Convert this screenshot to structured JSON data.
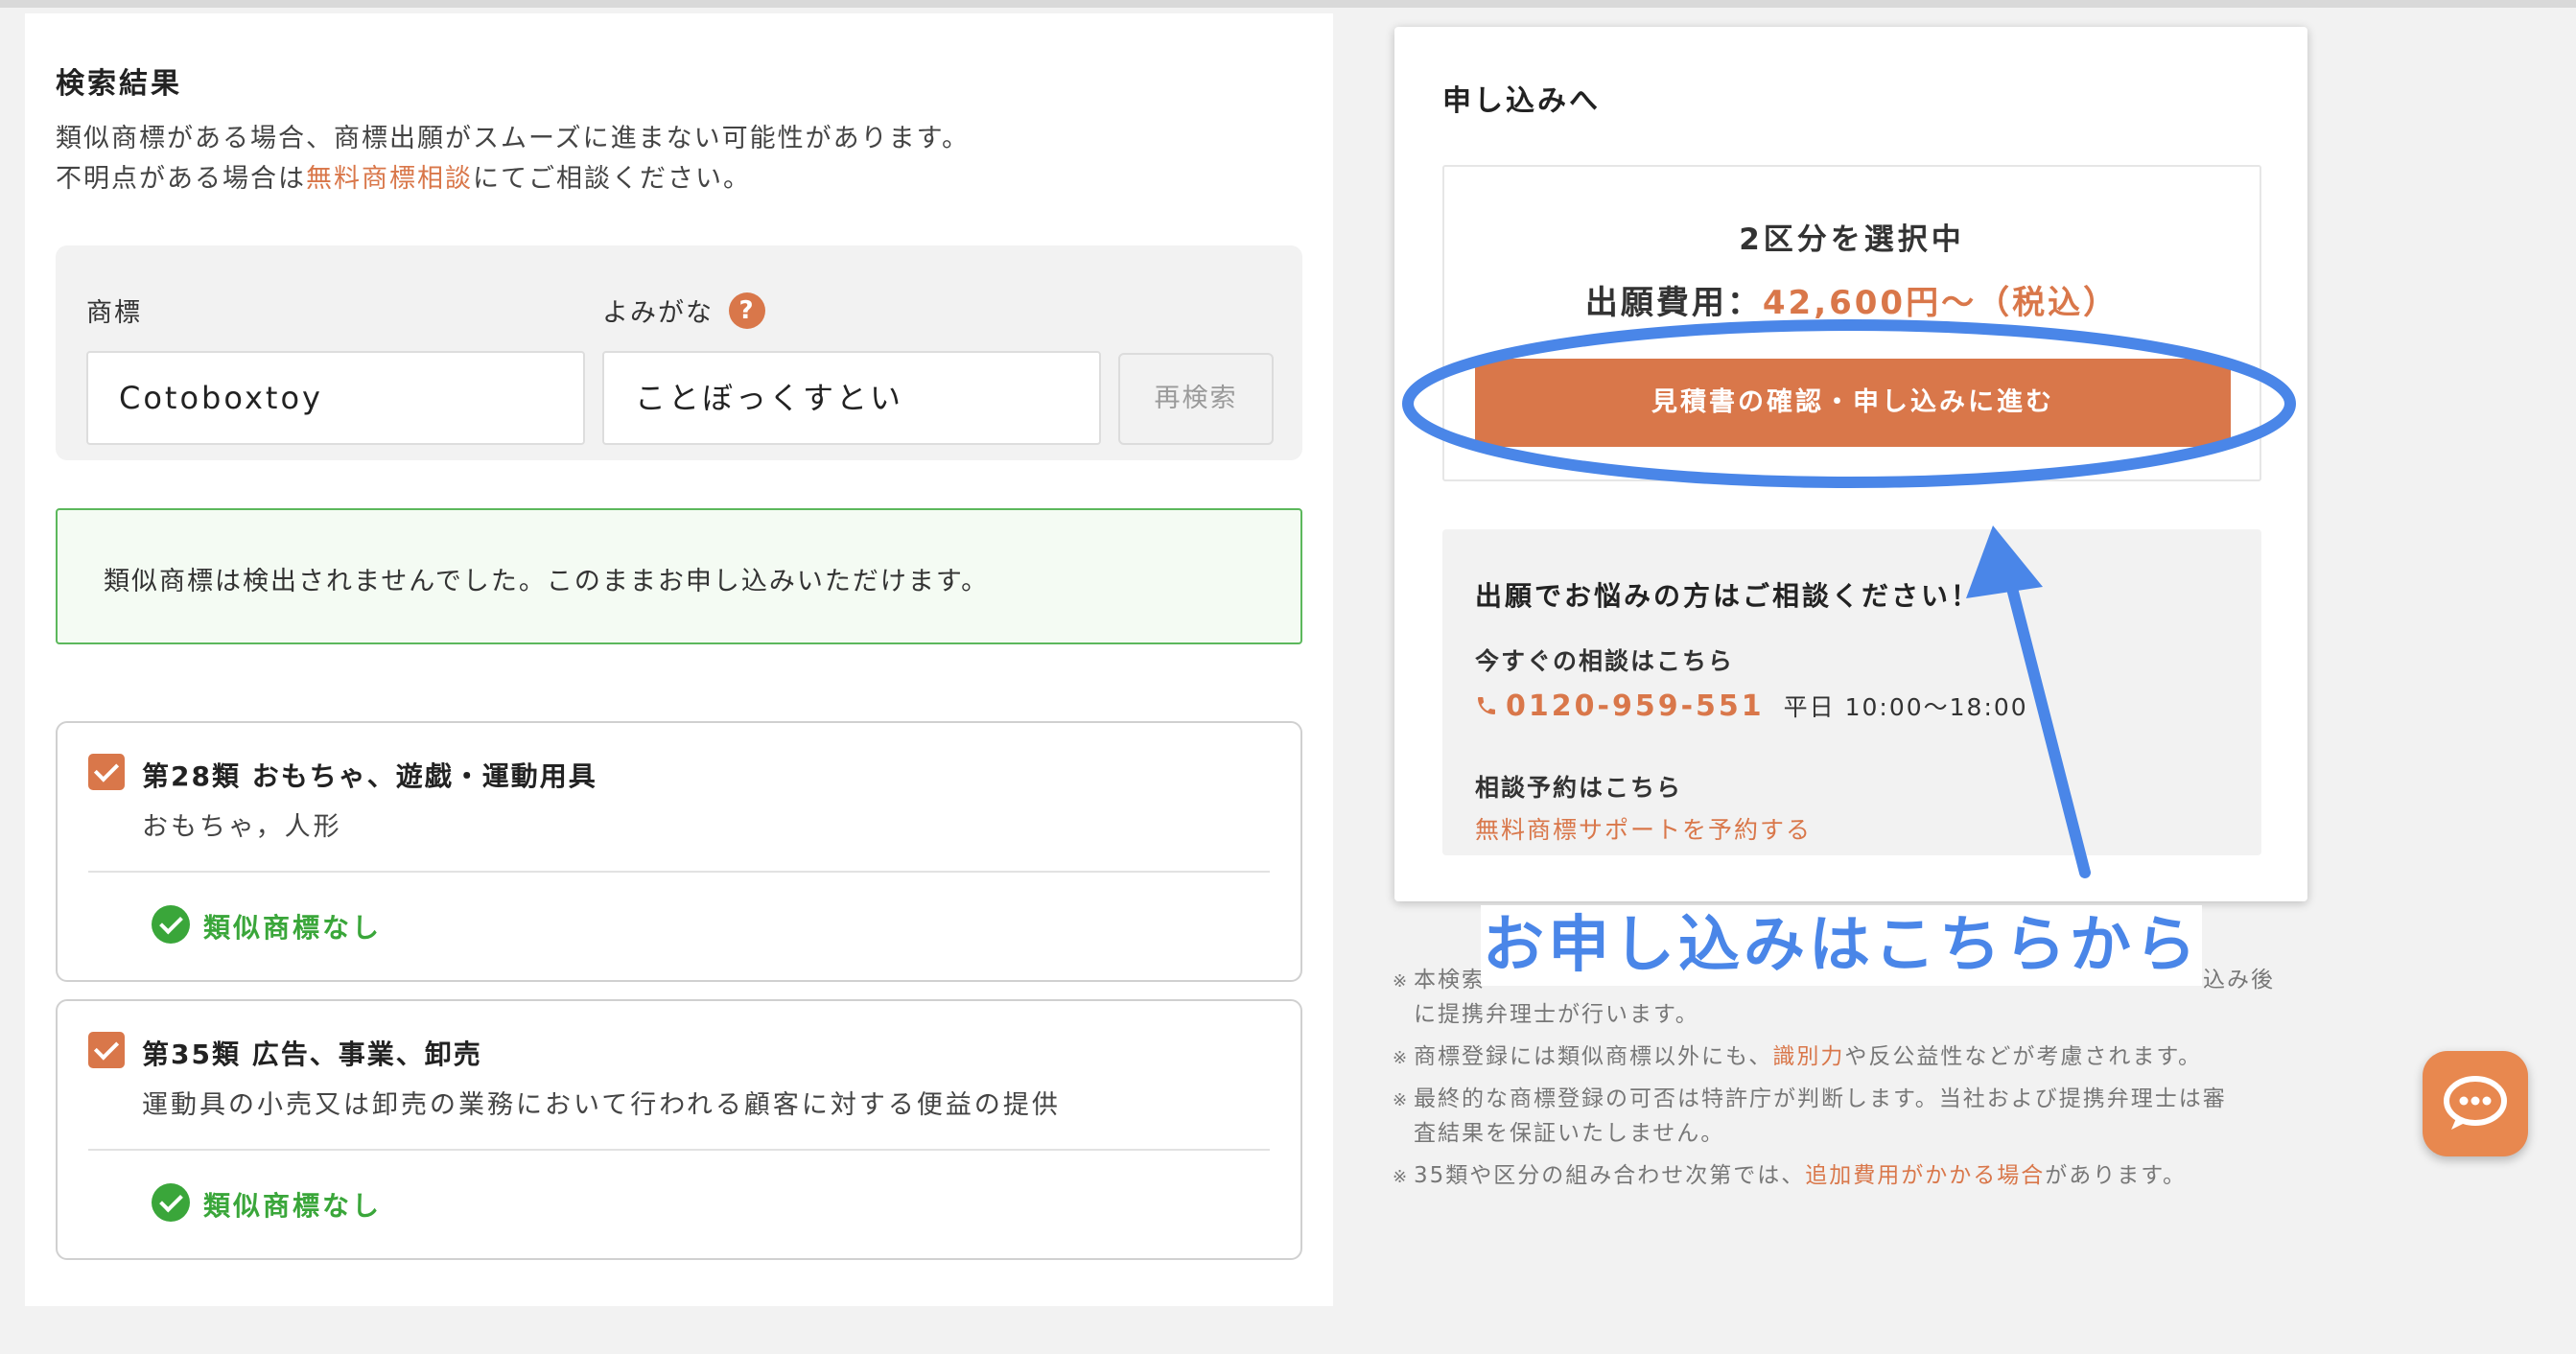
{
  "search": {
    "title": "検索結果",
    "desc_line1": "類似商標がある場合、商標出願がスムーズに進まない可能性があります。",
    "desc_line2_prefix": "不明点がある場合は",
    "desc_line2_link": "無料商標相談",
    "desc_line2_suffix": "にてご相談ください。",
    "trademark_label": "商標",
    "reading_label": "よみがな",
    "help_symbol": "?",
    "trademark_value": "Cotoboxtoy",
    "reading_value": "ことぼっくすとい",
    "research_button": "再検索"
  },
  "result_message": "類似商標は検出されませんでした。このままお申し込みいただけます。",
  "classes": [
    {
      "title": "第28類 おもちゃ、遊戯・運動用具",
      "goods": "おもちゃ，人形",
      "status": "類似商標なし"
    },
    {
      "title": "第35類 広告、事業、卸売",
      "goods": "運動具の小売又は卸売の業務において行われる顧客に対する便益の提供",
      "status": "類似商標なし"
    }
  ],
  "apply": {
    "title": "申し込みへ",
    "selected_count": "2区分を選択中",
    "fee_label": "出願費用：",
    "fee_value": "42,600円〜（税込）",
    "proceed_button": "見積書の確認・申し込みに進む",
    "consult_title": "出願でお悩みの方はご相談ください！",
    "consult_now_label": "今すぐの相談はこちら",
    "phone_number": "0120-959-551",
    "phone_hours": "平日 10:00〜18:00",
    "reserve_label": "相談予約はこちら",
    "reserve_link": "無料商標サポートを予約する"
  },
  "notes": {
    "mark": "※",
    "note1_line1_prefix": "本検索",
    "note1_line1_suffix": "込み後",
    "note1_line2": "に提携弁理士が行います。",
    "note2_prefix": "商標登録には類似商標以外にも、",
    "note2_link": "識別力",
    "note2_suffix": "や反公益性などが考慮されます。",
    "note3_line1": "最終的な商標登録の可否は特許庁が判断します。当社および提携弁理士は審",
    "note3_line2": "査結果を保証いたしません。",
    "note4_prefix": "35類や区分の組み合わせ次第では、",
    "note4_link": "追加費用がかかる場合",
    "note4_suffix": "があります。"
  },
  "annotation": {
    "label": "お申し込みはこちらから",
    "color": "#4a86e8"
  },
  "colors": {
    "accent": "#d9774a",
    "success": "#3aa63a",
    "annotation": "#4a86e8"
  },
  "icons": {
    "chat": "chat-bubble-icon",
    "phone": "phone-icon",
    "check": "check-circle-icon"
  }
}
